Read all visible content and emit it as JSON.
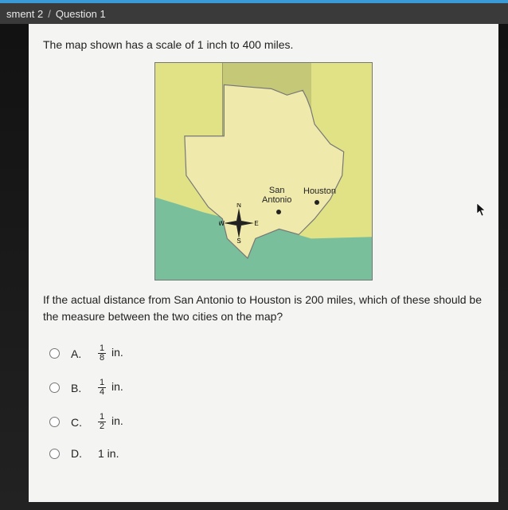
{
  "header": {
    "assessment": "sment 2",
    "separator": "/",
    "question": "Question 1"
  },
  "question": {
    "intro": "The map shown has a scale of 1 inch to 400 miles.",
    "tail": "If the actual distance from San Antonio to Houston is 200 miles, which of these should be the measure between the two cities on the map?"
  },
  "map": {
    "city1_line1": "San",
    "city1_line2": "Antonio",
    "city2": "Houston",
    "compass": {
      "n": "N",
      "e": "E",
      "s": "S",
      "w": "W"
    }
  },
  "answers": [
    {
      "letter": "A.",
      "num": "1",
      "den": "8",
      "unit": "in."
    },
    {
      "letter": "B.",
      "num": "1",
      "den": "4",
      "unit": "in."
    },
    {
      "letter": "C.",
      "num": "1",
      "den": "2",
      "unit": "in."
    },
    {
      "letter": "D.",
      "num": "",
      "den": "",
      "unit": "1 in."
    }
  ]
}
